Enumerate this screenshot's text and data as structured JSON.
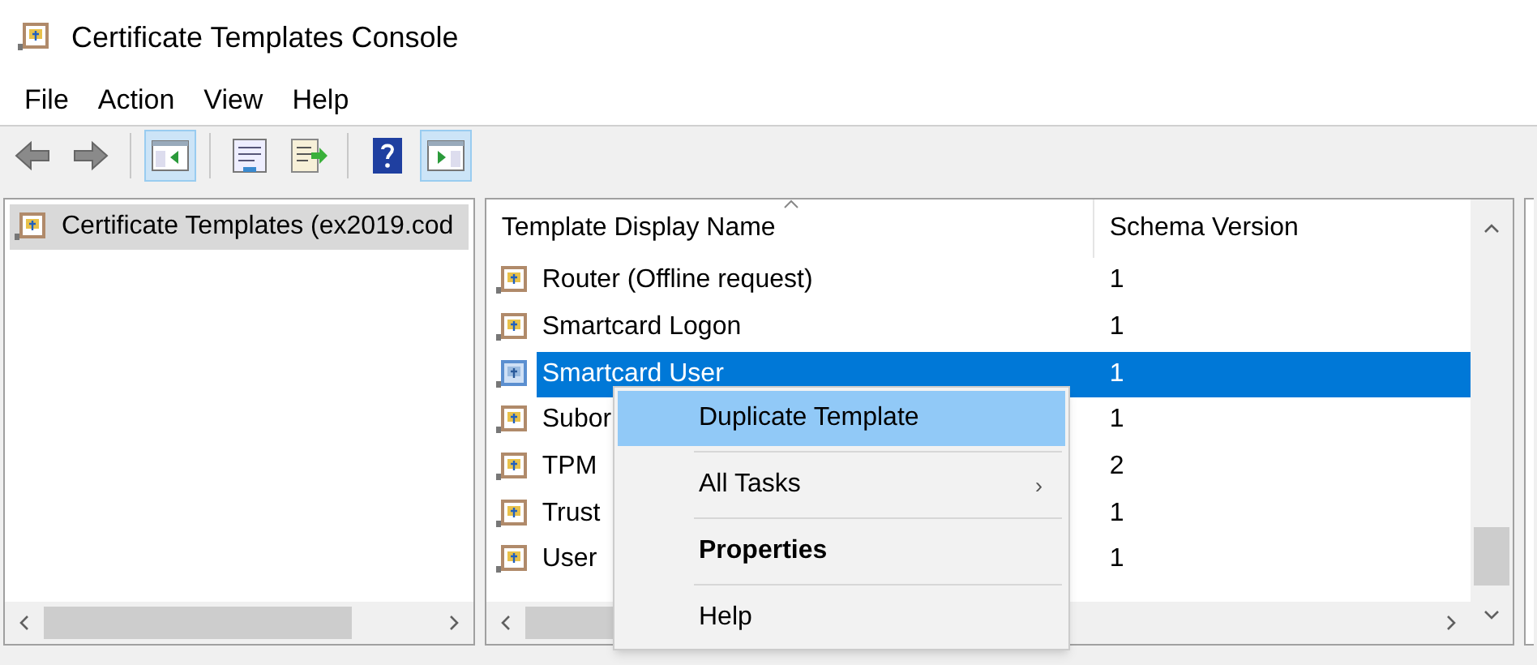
{
  "window": {
    "title": "Certificate Templates Console"
  },
  "menu_bar": [
    "File",
    "Action",
    "View",
    "Help"
  ],
  "toolbar": [
    {
      "kind": "back",
      "pressed": false
    },
    {
      "kind": "forward",
      "pressed": false
    },
    {
      "kind": "sep"
    },
    {
      "kind": "tree",
      "pressed": true
    },
    {
      "kind": "sep"
    },
    {
      "kind": "properties",
      "pressed": false
    },
    {
      "kind": "export",
      "pressed": false
    },
    {
      "kind": "sep"
    },
    {
      "kind": "help",
      "pressed": false
    },
    {
      "kind": "action-pane",
      "pressed": true
    }
  ],
  "tree": {
    "items": [
      {
        "label": "Certificate Templates (ex2019.cod",
        "selected": true
      }
    ]
  },
  "table": {
    "columns": [
      "Template Display Name",
      "Schema Version"
    ],
    "rows": [
      {
        "name": "Router (Offline request)",
        "version": "1",
        "selected": false
      },
      {
        "name": "Smartcard Logon",
        "version": "1",
        "selected": false
      },
      {
        "name": "Smartcard User",
        "version": "1",
        "selected": true
      },
      {
        "name": "Subor",
        "version": "1",
        "selected": false
      },
      {
        "name": "TPM",
        "version": "2",
        "selected": false
      },
      {
        "name": "Trust",
        "version": "1",
        "selected": false
      },
      {
        "name": "User",
        "version": "1",
        "selected": false
      }
    ]
  },
  "context_menu": [
    {
      "label": "Duplicate Template",
      "kind": "item",
      "selected": true,
      "bold": false
    },
    {
      "label": "All Tasks",
      "kind": "submenu",
      "selected": false,
      "bold": false
    },
    {
      "label": "Properties",
      "kind": "item",
      "selected": false,
      "bold": true
    },
    {
      "label": "Help",
      "kind": "item",
      "selected": false,
      "bold": false
    }
  ],
  "submenu_arrow": "›"
}
